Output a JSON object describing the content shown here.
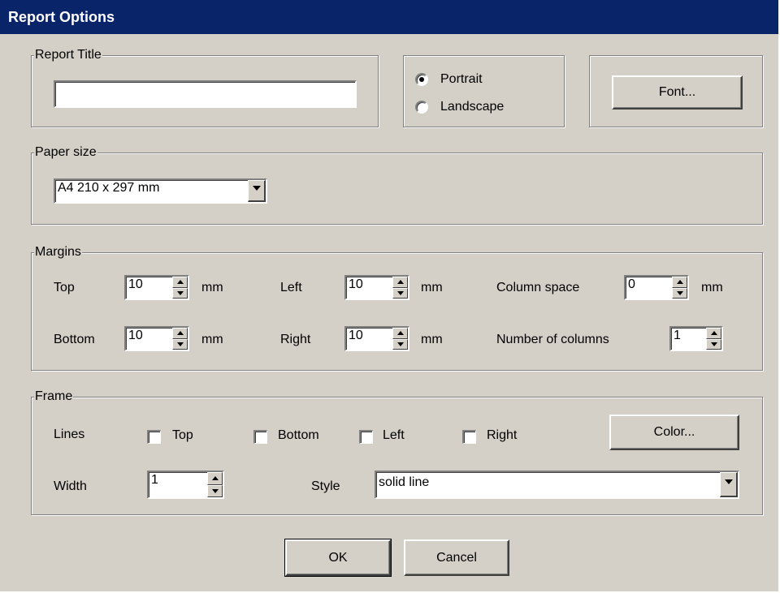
{
  "window": {
    "title": "Report Options"
  },
  "report_title": {
    "group_label": "Report Title",
    "value": ""
  },
  "orientation": {
    "options": [
      {
        "label": "Portrait",
        "selected": true
      },
      {
        "label": "Landscape",
        "selected": false
      }
    ]
  },
  "font_button": {
    "label": "Font..."
  },
  "paper_size": {
    "group_label": "Paper size",
    "selected": "A4 210 x 297 mm"
  },
  "margins": {
    "group_label": "Margins",
    "top": {
      "label": "Top",
      "value": "10",
      "unit": "mm"
    },
    "bottom": {
      "label": "Bottom",
      "value": "10",
      "unit": "mm"
    },
    "left": {
      "label": "Left",
      "value": "10",
      "unit": "mm"
    },
    "right": {
      "label": "Right",
      "value": "10",
      "unit": "mm"
    },
    "column_space": {
      "label": "Column space",
      "value": "0",
      "unit": "mm"
    },
    "number_of_columns": {
      "label": "Number of columns",
      "value": "1"
    }
  },
  "frame": {
    "group_label": "Frame",
    "lines_label": "Lines",
    "lines": [
      {
        "label": "Top",
        "checked": false
      },
      {
        "label": "Bottom",
        "checked": false
      },
      {
        "label": "Left",
        "checked": false
      },
      {
        "label": "Right",
        "checked": false
      }
    ],
    "color_button": "Color...",
    "width_label": "Width",
    "width_value": "1",
    "style_label": "Style",
    "style_value": "solid line"
  },
  "buttons": {
    "ok": "OK",
    "cancel": "Cancel"
  },
  "colors": {
    "titlebar": "#0a246a",
    "face": "#d4d0c8"
  }
}
